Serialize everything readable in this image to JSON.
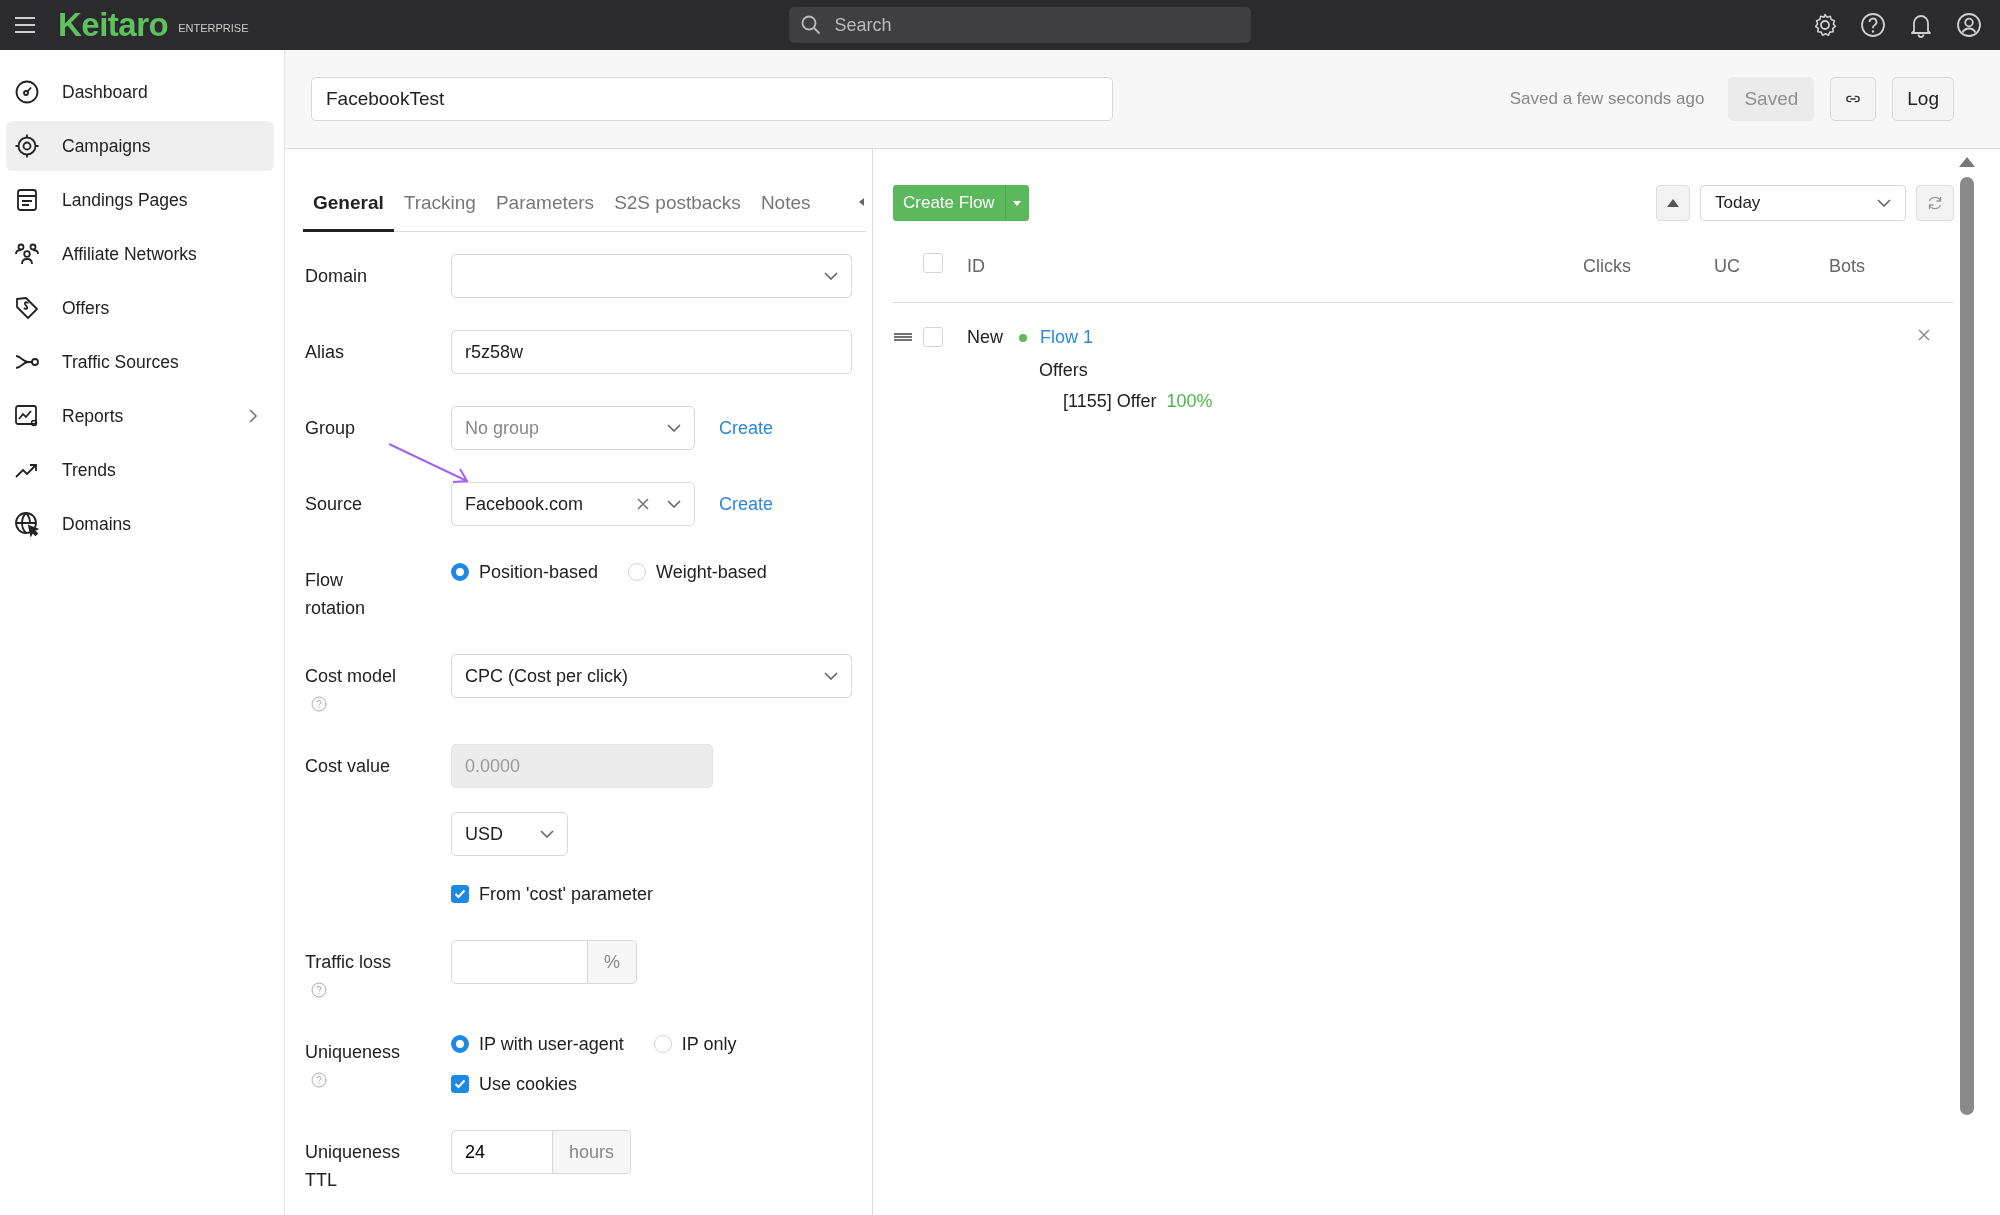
{
  "topbar": {
    "logo": "Keitaro",
    "edition": "ENTERPRISE",
    "search": {
      "placeholder": "Search"
    }
  },
  "sidebar": {
    "items": [
      {
        "label": "Dashboard",
        "selected": false,
        "has_submenu": false
      },
      {
        "label": "Campaigns",
        "selected": true,
        "has_submenu": false
      },
      {
        "label": "Landings Pages",
        "selected": false,
        "has_submenu": false
      },
      {
        "label": "Affiliate Networks",
        "selected": false,
        "has_submenu": false
      },
      {
        "label": "Offers",
        "selected": false,
        "has_submenu": false
      },
      {
        "label": "Traffic Sources",
        "selected": false,
        "has_submenu": false
      },
      {
        "label": "Reports",
        "selected": false,
        "has_submenu": true
      },
      {
        "label": "Trends",
        "selected": false,
        "has_submenu": false
      },
      {
        "label": "Domains",
        "selected": false,
        "has_submenu": false
      }
    ]
  },
  "campaign": {
    "name": "FacebookTest",
    "saved_note": "Saved a few seconds ago",
    "save_button": {
      "label": "Saved",
      "disabled": true
    },
    "log_button": {
      "label": "Log"
    }
  },
  "tabs": [
    {
      "label": "General",
      "selected": true
    },
    {
      "label": "Tracking",
      "selected": false
    },
    {
      "label": "Parameters",
      "selected": false
    },
    {
      "label": "S2S postbacks",
      "selected": false
    },
    {
      "label": "Notes",
      "selected": false
    }
  ],
  "form": {
    "rows": [
      {
        "label": "Domain",
        "help": false,
        "controls": [
          {
            "kind": "select"
          }
        ]
      },
      {
        "label": "Alias",
        "help": false,
        "controls": [
          {
            "kind": "text",
            "value": "r5z58w"
          }
        ]
      },
      {
        "label": "Group",
        "help": false,
        "controls": [
          {
            "kind": "combo",
            "placeholder": "No group",
            "clearable": false
          },
          {
            "kind": "link",
            "label": "Create"
          }
        ]
      },
      {
        "label": "Source",
        "help": false,
        "controls": [
          {
            "kind": "combo",
            "value": "Facebook.com",
            "clearable": true
          },
          {
            "kind": "link",
            "label": "Create"
          }
        ]
      },
      {
        "label": "Flow rotation",
        "help": false,
        "controls": [
          {
            "kind": "radio",
            "label": "Position-based",
            "selected": true
          },
          {
            "kind": "radio",
            "label": "Weight-based",
            "selected": false
          }
        ]
      },
      {
        "label": "Cost model",
        "help": true,
        "controls": [
          {
            "kind": "select",
            "value": "CPC (Cost per click)"
          }
        ]
      },
      {
        "label": "Cost value",
        "help": false,
        "controls": [
          {
            "kind": "number",
            "placeholder": "0.0000",
            "disabled": true
          },
          {
            "kind": "currency",
            "value": "USD"
          },
          {
            "kind": "checkbox",
            "label": "From 'cost' parameter",
            "checked": true
          }
        ]
      },
      {
        "label": "Traffic loss",
        "help": true,
        "controls": [
          {
            "kind": "addon",
            "addon": "%"
          }
        ]
      },
      {
        "label": "Uniqueness",
        "help": true,
        "controls": [
          {
            "kind": "radio",
            "label": "IP with user-agent",
            "selected": true
          },
          {
            "kind": "radio",
            "label": "IP only",
            "selected": false
          },
          {
            "kind": "checkbox",
            "label": "Use cookies",
            "checked": true
          }
        ]
      },
      {
        "label": "Uniqueness TTL",
        "help": false,
        "controls": [
          {
            "kind": "addon",
            "value": "24",
            "addon": "hours"
          }
        ]
      }
    ]
  },
  "flows": {
    "create_button": "Create Flow",
    "period": "Today",
    "all_selected": false,
    "columns": [
      "ID",
      "Clicks",
      "UC",
      "Bots"
    ],
    "rows": [
      {
        "status": "New",
        "color": "#5cb85c",
        "name": "Flow 1",
        "selected": false,
        "offers_label": "Offers",
        "offers": [
          {
            "name": "[1155] Offer",
            "share": "100%"
          }
        ]
      }
    ]
  }
}
